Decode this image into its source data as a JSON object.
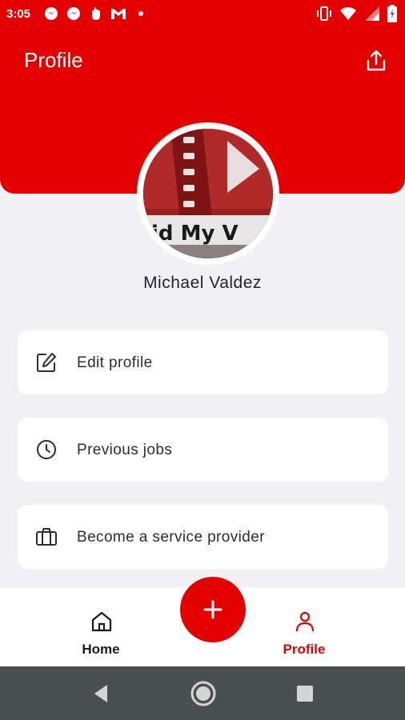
{
  "status_bar": {
    "time": "3:05",
    "notification_icons": [
      "messenger-icon",
      "messenger-icon",
      "hand-icon",
      "gmail-icon",
      "dot-icon"
    ],
    "system_icons": [
      "vibrate-icon",
      "wifi-icon",
      "signal-icon",
      "battery-icon"
    ]
  },
  "header": {
    "title": "Profile",
    "share_icon": "share-icon"
  },
  "profile": {
    "name": "Michael Valdez",
    "avatar_caption": "id My V"
  },
  "menu": {
    "items": [
      {
        "label": "Edit profile",
        "icon": "edit-icon"
      },
      {
        "label": "Previous jobs",
        "icon": "clock-icon"
      },
      {
        "label": "Become a service provider",
        "icon": "briefcase-icon"
      }
    ]
  },
  "bottom_nav": {
    "items": [
      {
        "label": "Home",
        "icon": "home-icon",
        "active": false
      },
      {
        "label": "Profile",
        "icon": "person-icon",
        "active": true
      }
    ],
    "fab_icon": "plus-icon"
  },
  "system_nav": [
    "back-icon",
    "home-circle-icon",
    "recents-icon"
  ],
  "colors": {
    "accent": "#e50000",
    "background": "#f0f0f5",
    "text": "#1e2230",
    "sysnav": "#4a5052"
  }
}
